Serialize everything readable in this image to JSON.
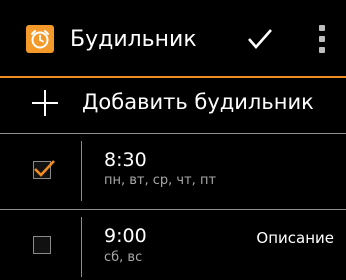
{
  "header": {
    "title": "Будильник",
    "app_icon": "alarm-clock-icon",
    "confirm_icon": "checkmark-icon",
    "menu_icon": "overflow-menu-icon"
  },
  "add_alarm": {
    "label": "Добавить будильник",
    "icon": "plus-icon"
  },
  "alarms": [
    {
      "time": "8:30",
      "days": "пн, вт, ср, чт, пт",
      "description": "",
      "enabled": true
    },
    {
      "time": "9:00",
      "days": "сб, вс",
      "description": "Описание",
      "enabled": false
    }
  ],
  "colors": {
    "accent": "#f08c1e",
    "background": "#000000",
    "text": "#ffffff",
    "secondary_text": "#a8a8a8"
  }
}
